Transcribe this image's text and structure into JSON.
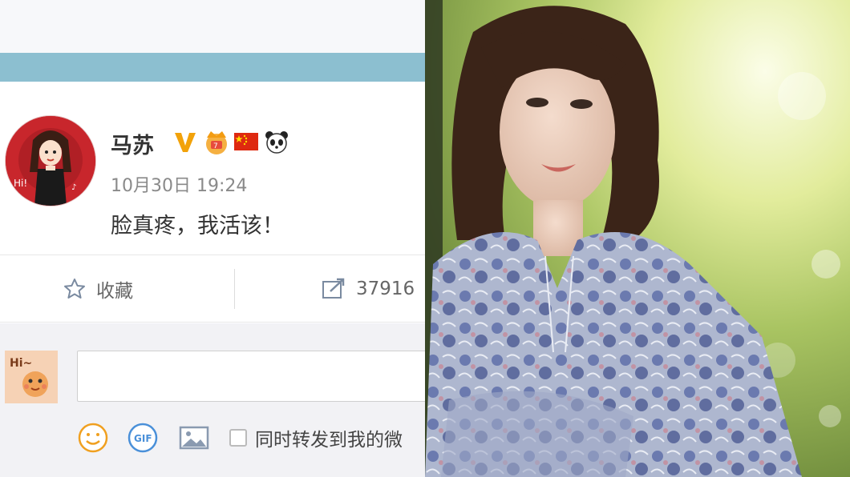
{
  "post": {
    "username": "马苏",
    "badges": [
      "verified-v-icon",
      "crown-level-icon",
      "china-flag-icon",
      "panda-icon"
    ],
    "timestamp": "10月30日 19:24",
    "text": "脸真疼，我活该！"
  },
  "actions": {
    "favorite_label": "收藏",
    "repost_count": "37916"
  },
  "comment": {
    "input_value": "",
    "repost_option_label": "同时转发到我的微"
  },
  "colors": {
    "header_bar": "#8cbfd0",
    "verified_badge": "#f2a20a",
    "emoji_icon": "#f0a020",
    "gif_icon": "#4a90d9"
  }
}
